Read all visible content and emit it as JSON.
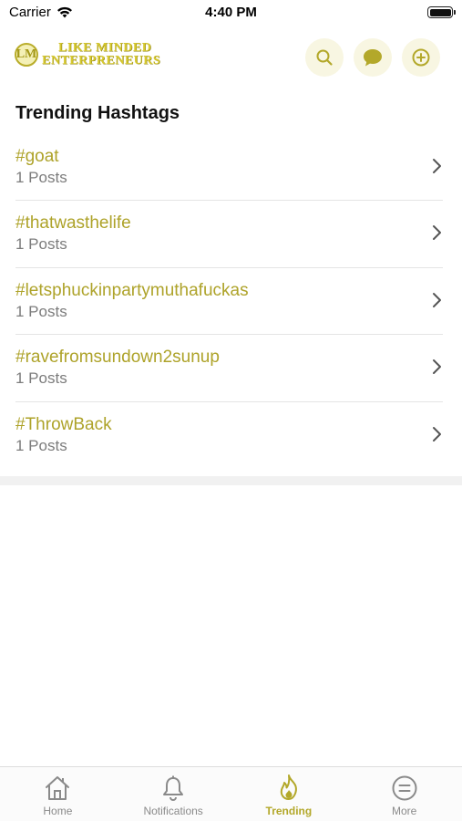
{
  "status_bar": {
    "carrier": "Carrier",
    "time": "4:40 PM",
    "wifi_icon": "wifi-icon",
    "battery_icon": "battery-icon"
  },
  "header": {
    "logo_mark": "LM",
    "logo_line1": "LIKE MINDED",
    "logo_line2": "ENTERPRENEURS",
    "actions": [
      {
        "name": "search-icon"
      },
      {
        "name": "chat-bubble-icon"
      },
      {
        "name": "add-circle-icon"
      }
    ]
  },
  "section": {
    "title": "Trending Hashtags"
  },
  "hashtags": [
    {
      "tag": "#goat",
      "count": "1 Posts"
    },
    {
      "tag": "#thatwasthelife",
      "count": "1 Posts"
    },
    {
      "tag": "#letsphuckinpartymuthafuckas",
      "count": "1 Posts"
    },
    {
      "tag": "#ravefromsundown2sunup",
      "count": "1 Posts"
    },
    {
      "tag": "#ThrowBack",
      "count": "1 Posts"
    }
  ],
  "tabs": [
    {
      "label": "Home",
      "icon": "home-icon",
      "active": false
    },
    {
      "label": "Notifications",
      "icon": "bell-icon",
      "active": false
    },
    {
      "label": "Trending",
      "icon": "flame-icon",
      "active": true
    },
    {
      "label": "More",
      "icon": "menu-circle-icon",
      "active": false
    }
  ],
  "colors": {
    "accent": "#b3a82a",
    "accent_bg": "#f8f6e2",
    "muted_text": "#7c7c7c"
  }
}
